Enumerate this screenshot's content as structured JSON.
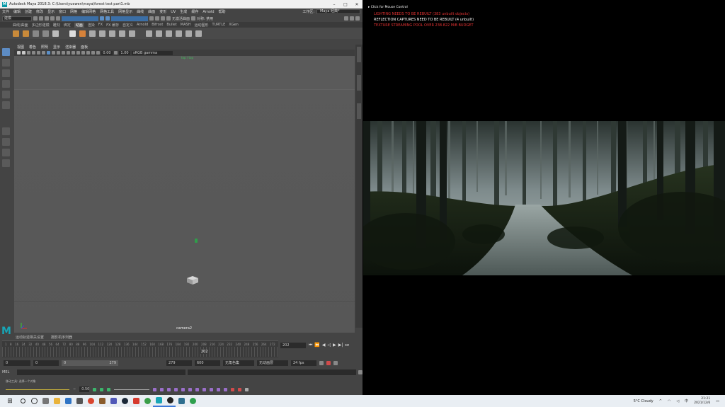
{
  "maya": {
    "title": "Autodesk Maya 2018.3: C:\\Users\\yuewen\\maya\\forest test part1.mb",
    "menus": [
      "文件",
      "编辑",
      "创建",
      "修改",
      "显示",
      "窗口",
      "网格",
      "编辑网格",
      "网格工具",
      "网格显示",
      "曲线",
      "曲面",
      "变形",
      "UV",
      "生成",
      "缓存",
      "Arnold",
      "帮助"
    ],
    "workspace_label": "工作区:",
    "workspace_value": "Maya 经典*",
    "menu_mode": "建模",
    "statusline_text": "无激活曲面",
    "symmetry_label": "对称: 禁用",
    "shelf_tabs": [
      "曲线/曲面",
      "多边形建模",
      "雕刻",
      "绑定",
      "动画",
      "渲染",
      "FX",
      "FX 缓存",
      "自定义",
      "Arnold",
      "Bifrost",
      "Bullet",
      "MASH",
      "运动图形",
      "TURTLE",
      "XGen"
    ],
    "active_shelf_tab": "动画",
    "panel_menus": [
      "视图",
      "着色",
      "照明",
      "显示",
      "渲染器",
      "面板"
    ],
    "near_value": "0.00",
    "far_value": "1.00",
    "colorspace": "sRGB gamma",
    "camera_label": "camera2",
    "view_top_label": "top / top",
    "timeline_tabs": [
      "运动轨迹相关设置",
      "摄影机序列器"
    ],
    "ticks": [
      "1",
      "8",
      "16",
      "24",
      "32",
      "40",
      "48",
      "56",
      "64",
      "72",
      "80",
      "88",
      "96",
      "104",
      "112",
      "120",
      "128",
      "136",
      "144",
      "152",
      "160",
      "168",
      "176",
      "184",
      "192",
      "200",
      "208",
      "216",
      "224",
      "232",
      "240",
      "248",
      "256",
      "264",
      "272"
    ],
    "current_frame_marker": "202",
    "current_frame": "202",
    "range_start": "0",
    "range_start2": "0",
    "range_inner_start": "0",
    "range_inner_end": "279",
    "range_end": "279",
    "range_end2": "600",
    "anim_layer": "无角色集",
    "anim_layer2": "无动画层",
    "fps": "24 fps",
    "mel_label": "MEL",
    "help_line": "移动工具: 选择一个对象",
    "bottom_value": "0.50"
  },
  "game": {
    "mouse_control": "Click for Mouse Control",
    "msg1": "LIGHTING NEEDS TO BE REBUILT (383 unbuilt objects)",
    "msg2": "REFLECTION CAPTURES NEED TO BE REBUILT (4 unbuilt)",
    "msg3": "TEXTURE STREAMING POOL OVER 238.822 MiB BUDGET",
    "colors": {
      "red": "#e23232",
      "white": "#ffffff"
    }
  },
  "taskbar": {
    "weather": "5°C  Cloudy",
    "time": "21:21",
    "date": "2021/12/6",
    "icons": [
      "search-icon",
      "cortana-icon",
      "taskview-icon",
      "explorer-icon",
      "mail-icon",
      "app-icon",
      "chrome-icon",
      "app2-icon",
      "teams-icon",
      "steam-icon",
      "wps-icon",
      "chrome2-icon",
      "maya-icon",
      "unreal-icon",
      "app3-icon",
      "app4-icon"
    ]
  }
}
